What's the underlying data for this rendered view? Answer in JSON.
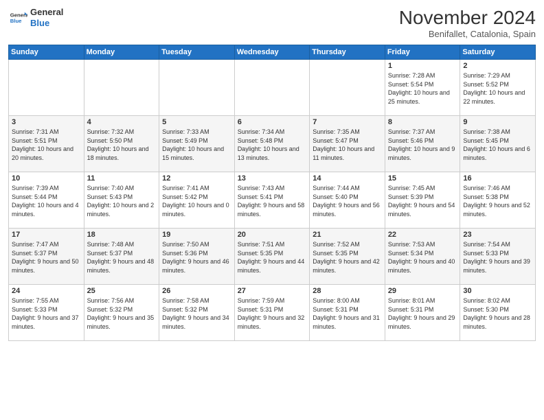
{
  "header": {
    "logo_line1": "General",
    "logo_line2": "Blue",
    "month_title": "November 2024",
    "location": "Benifallet, Catalonia, Spain"
  },
  "days_of_week": [
    "Sunday",
    "Monday",
    "Tuesday",
    "Wednesday",
    "Thursday",
    "Friday",
    "Saturday"
  ],
  "weeks": [
    [
      null,
      null,
      null,
      null,
      null,
      {
        "day": "1",
        "sunrise": "7:28 AM",
        "sunset": "5:54 PM",
        "daylight": "10 hours and 25 minutes."
      },
      {
        "day": "2",
        "sunrise": "7:29 AM",
        "sunset": "5:52 PM",
        "daylight": "10 hours and 22 minutes."
      }
    ],
    [
      {
        "day": "3",
        "sunrise": "7:31 AM",
        "sunset": "5:51 PM",
        "daylight": "10 hours and 20 minutes."
      },
      {
        "day": "4",
        "sunrise": "7:32 AM",
        "sunset": "5:50 PM",
        "daylight": "10 hours and 18 minutes."
      },
      {
        "day": "5",
        "sunrise": "7:33 AM",
        "sunset": "5:49 PM",
        "daylight": "10 hours and 15 minutes."
      },
      {
        "day": "6",
        "sunrise": "7:34 AM",
        "sunset": "5:48 PM",
        "daylight": "10 hours and 13 minutes."
      },
      {
        "day": "7",
        "sunrise": "7:35 AM",
        "sunset": "5:47 PM",
        "daylight": "10 hours and 11 minutes."
      },
      {
        "day": "8",
        "sunrise": "7:37 AM",
        "sunset": "5:46 PM",
        "daylight": "10 hours and 9 minutes."
      },
      {
        "day": "9",
        "sunrise": "7:38 AM",
        "sunset": "5:45 PM",
        "daylight": "10 hours and 6 minutes."
      }
    ],
    [
      {
        "day": "10",
        "sunrise": "7:39 AM",
        "sunset": "5:44 PM",
        "daylight": "10 hours and 4 minutes."
      },
      {
        "day": "11",
        "sunrise": "7:40 AM",
        "sunset": "5:43 PM",
        "daylight": "10 hours and 2 minutes."
      },
      {
        "day": "12",
        "sunrise": "7:41 AM",
        "sunset": "5:42 PM",
        "daylight": "10 hours and 0 minutes."
      },
      {
        "day": "13",
        "sunrise": "7:43 AM",
        "sunset": "5:41 PM",
        "daylight": "9 hours and 58 minutes."
      },
      {
        "day": "14",
        "sunrise": "7:44 AM",
        "sunset": "5:40 PM",
        "daylight": "9 hours and 56 minutes."
      },
      {
        "day": "15",
        "sunrise": "7:45 AM",
        "sunset": "5:39 PM",
        "daylight": "9 hours and 54 minutes."
      },
      {
        "day": "16",
        "sunrise": "7:46 AM",
        "sunset": "5:38 PM",
        "daylight": "9 hours and 52 minutes."
      }
    ],
    [
      {
        "day": "17",
        "sunrise": "7:47 AM",
        "sunset": "5:37 PM",
        "daylight": "9 hours and 50 minutes."
      },
      {
        "day": "18",
        "sunrise": "7:48 AM",
        "sunset": "5:37 PM",
        "daylight": "9 hours and 48 minutes."
      },
      {
        "day": "19",
        "sunrise": "7:50 AM",
        "sunset": "5:36 PM",
        "daylight": "9 hours and 46 minutes."
      },
      {
        "day": "20",
        "sunrise": "7:51 AM",
        "sunset": "5:35 PM",
        "daylight": "9 hours and 44 minutes."
      },
      {
        "day": "21",
        "sunrise": "7:52 AM",
        "sunset": "5:35 PM",
        "daylight": "9 hours and 42 minutes."
      },
      {
        "day": "22",
        "sunrise": "7:53 AM",
        "sunset": "5:34 PM",
        "daylight": "9 hours and 40 minutes."
      },
      {
        "day": "23",
        "sunrise": "7:54 AM",
        "sunset": "5:33 PM",
        "daylight": "9 hours and 39 minutes."
      }
    ],
    [
      {
        "day": "24",
        "sunrise": "7:55 AM",
        "sunset": "5:33 PM",
        "daylight": "9 hours and 37 minutes."
      },
      {
        "day": "25",
        "sunrise": "7:56 AM",
        "sunset": "5:32 PM",
        "daylight": "9 hours and 35 minutes."
      },
      {
        "day": "26",
        "sunrise": "7:58 AM",
        "sunset": "5:32 PM",
        "daylight": "9 hours and 34 minutes."
      },
      {
        "day": "27",
        "sunrise": "7:59 AM",
        "sunset": "5:31 PM",
        "daylight": "9 hours and 32 minutes."
      },
      {
        "day": "28",
        "sunrise": "8:00 AM",
        "sunset": "5:31 PM",
        "daylight": "9 hours and 31 minutes."
      },
      {
        "day": "29",
        "sunrise": "8:01 AM",
        "sunset": "5:31 PM",
        "daylight": "9 hours and 29 minutes."
      },
      {
        "day": "30",
        "sunrise": "8:02 AM",
        "sunset": "5:30 PM",
        "daylight": "9 hours and 28 minutes."
      }
    ]
  ]
}
